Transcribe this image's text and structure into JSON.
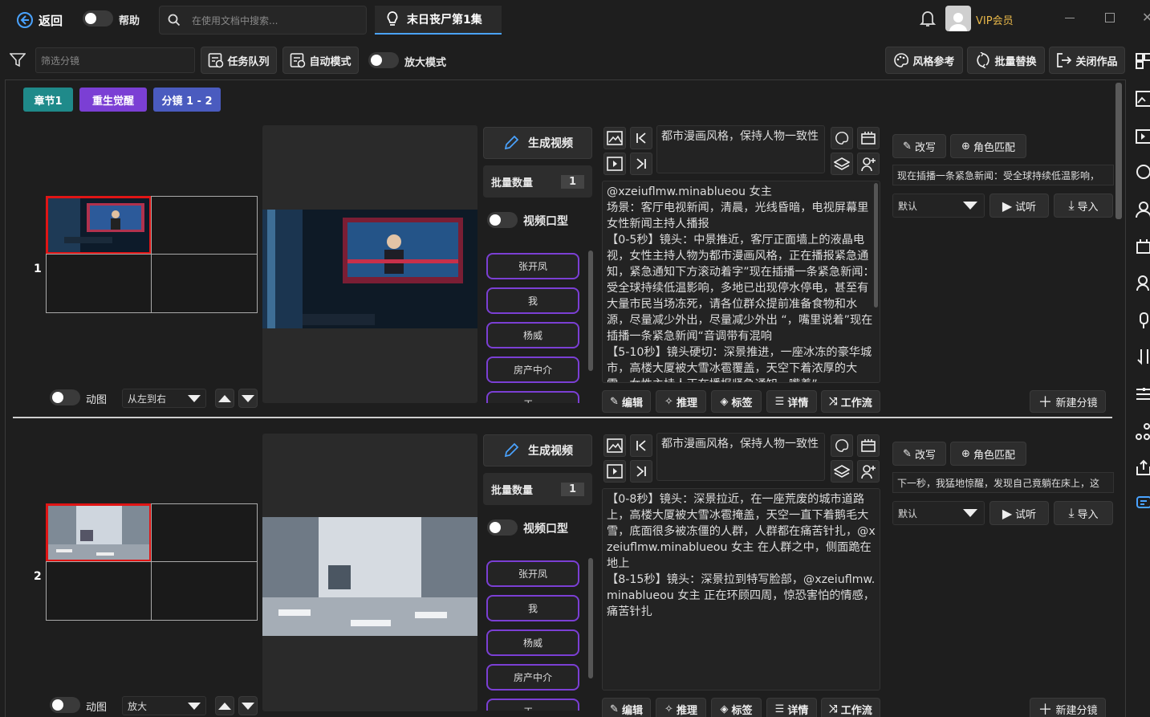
{
  "titlebar": {
    "back_label": "返回",
    "help_label": "帮助",
    "search_placeholder": "在使用文档中搜索...",
    "project_tab": "末日丧尸第1集",
    "vip_label": "VIP会员"
  },
  "toolbar": {
    "filter_placeholder": "筛选分镜",
    "task_queue": "任务队列",
    "auto_mode": "自动模式",
    "zoom_mode": "放大模式",
    "style_ref": "风格参考",
    "batch_replace": "批量替换",
    "close_work": "关闭作品"
  },
  "breadcrumb": {
    "chapter": "章节1",
    "section": "重生觉醒",
    "shot": "分镜 1 - 2"
  },
  "colors": {
    "chapter": "#1f8a8a",
    "section": "#7b3fd4",
    "shot": "#4a5bbf",
    "selected_border": "#e01515"
  },
  "shots": [
    {
      "index": "1",
      "anim_label": "动图",
      "motion": "从左到右",
      "generate_video": "生成视频",
      "batch_label": "批量数量",
      "batch_count": "1",
      "lipsync_label": "视频口型",
      "characters": [
        "张开凤",
        "我",
        "杨威",
        "房产中介",
        "王..."
      ],
      "style_prompt": "都市漫画风格，保持人物一致性",
      "script": "@xzeiuflmw.minablueou 女主\n场景：客厅电视新闻，清晨，光线昏暗，电视屏幕里女性新闻主持人播报\n【0-5秒】镜头：中景推近，客厅正面墙上的液晶电视，女性主持人物为都市漫画风格，正在播报紧急通知，紧急通知下方滚动着字”现在插播一条紧急新闻：受全球持续低温影响，多地已出现停水停电，甚至有大量市民当场冻死，请各位群众提前准备食物和水源，尽量减少外出，尽量减少外出 “，嘴里说着”现在插播一条紧急新闻“音调带有混响\n【5-10秒】镜头硬切：深景推进，一座冰冻的豪华城市，高楼大厦被大雪冰雹覆盖，天空下着浓厚的大雪，女性主持人正在播报紧急通知，嘴着”",
      "rewrite": "改写",
      "role_match": "角色匹配",
      "narration": "现在插播一条紧急新闻：受全球持续低温影响，",
      "voice": "默认",
      "listen": "试听",
      "import": "导入",
      "actions": [
        "编辑",
        "推理",
        "标签",
        "详情",
        "工作流"
      ],
      "new_shot": "新建分镜"
    },
    {
      "index": "2",
      "anim_label": "动图",
      "motion": "放大",
      "generate_video": "生成视频",
      "batch_label": "批量数量",
      "batch_count": "1",
      "lipsync_label": "视频口型",
      "characters": [
        "张开凤",
        "我",
        "杨威",
        "房产中介",
        "王..."
      ],
      "style_prompt": "都市漫画风格，保持人物一致性",
      "script": "【0-8秒】镜头：深景拉近，在一座荒废的城市道路上，高楼大厦被大雪冰雹掩盖，天空一直下着鹅毛大雪，底面很多被冻僵的人群，人群都在痛苦针扎，@xzeiuflmw.minablueou 女主 在人群之中，侧面跪在地上\n【8-15秒】镜头：深景拉到特写脸部，@xzeiuflmw.minablueou 女主 正在环顾四周，惊恐害怕的情感，痛苦针扎",
      "rewrite": "改写",
      "role_match": "角色匹配",
      "narration": "下一秒，我猛地惊醒，发现自己竟躺在床上，这",
      "voice": "默认",
      "listen": "试听",
      "import": "导入",
      "actions": [
        "编辑",
        "推理",
        "标签",
        "详情",
        "工作流"
      ],
      "new_shot": "新建分镜"
    }
  ]
}
